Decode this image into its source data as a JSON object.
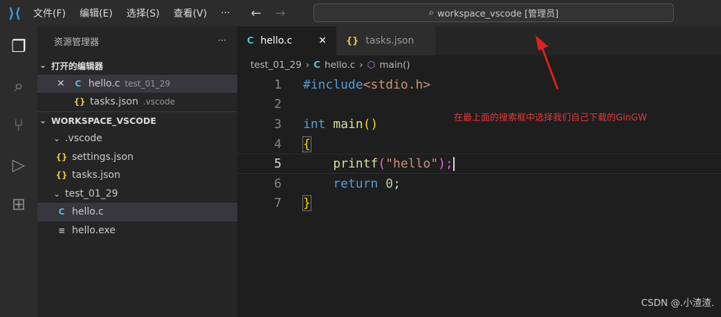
{
  "menu": [
    "文件(F)",
    "编辑(E)",
    "选择(S)",
    "查看(V)",
    "···"
  ],
  "search": "workspace_vscode [管理员]",
  "sidebar": {
    "title": "资源管理器",
    "more": "···",
    "open_editors": "打开的编辑器",
    "open": [
      {
        "name": "hello.c",
        "desc": "test_01_29"
      },
      {
        "name": "tasks.json",
        "desc": ".vscode"
      }
    ],
    "workspace": "WORKSPACE_VSCODE",
    "tree": [
      ".vscode",
      "settings.json",
      "tasks.json",
      "test_01_29",
      "hello.c",
      "hello.exe"
    ]
  },
  "tabs": [
    {
      "label": "hello.c"
    },
    {
      "label": "tasks.json"
    }
  ],
  "breadcrumb": [
    "test_01_29",
    "hello.c",
    "main()"
  ],
  "code": {
    "l1a": "#include",
    "l1b": "<stdio.h>",
    "l3a": "int",
    "l3b": " main",
    "l3c": "()",
    "l4": "{",
    "l5a": "    printf",
    "l5b": "(",
    "l5c": "\"hello\"",
    "l5d": ");",
    "l6a": "    return",
    "l6b": " 0",
    "l6c": ";",
    "l7": "}"
  },
  "line_numbers": [
    "1",
    "2",
    "3",
    "4",
    "5",
    "6",
    "7"
  ],
  "annotation": "在最上面的搜索框中选择我们自己下载的GinGW",
  "watermark": "CSDN @.小渣渣."
}
